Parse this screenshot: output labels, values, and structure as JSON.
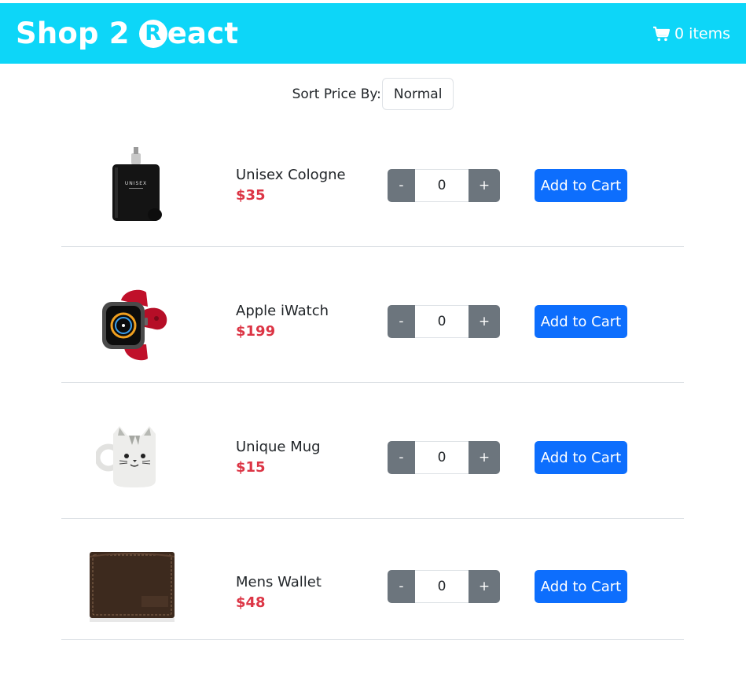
{
  "header": {
    "brand_prefix": "Shop 2",
    "brand_logo_letter": "R",
    "brand_suffix": "eact",
    "cart_count_text": "0 items",
    "bg_color": "#0dd6f8"
  },
  "sort": {
    "label": "Sort Price By:",
    "selected": "Normal"
  },
  "products": [
    {
      "name": "Unisex Cologne",
      "price": "$35",
      "quantity": "0",
      "decrement_label": "-",
      "increment_label": "+",
      "add_label": "Add to Cart",
      "image_icon": "cologne-bottle"
    },
    {
      "name": "Apple iWatch",
      "price": "$199",
      "quantity": "0",
      "decrement_label": "-",
      "increment_label": "+",
      "add_label": "Add to Cart",
      "image_icon": "smartwatch"
    },
    {
      "name": "Unique Mug",
      "price": "$15",
      "quantity": "0",
      "decrement_label": "-",
      "increment_label": "+",
      "add_label": "Add to Cart",
      "image_icon": "cat-mug"
    },
    {
      "name": "Mens Wallet",
      "price": "$48",
      "quantity": "0",
      "decrement_label": "-",
      "increment_label": "+",
      "add_label": "Add to Cart",
      "image_icon": "leather-wallet"
    }
  ],
  "colors": {
    "price": "#dc3545",
    "primary_button": "#0d6efd",
    "stepper_button": "#6c757d"
  }
}
